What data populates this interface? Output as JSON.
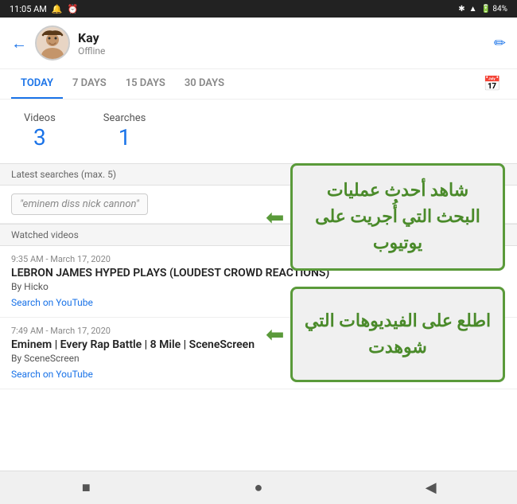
{
  "statusBar": {
    "time": "11:05 AM",
    "icons": [
      "alarm",
      "bluetooth",
      "signal",
      "battery"
    ],
    "battery": "84"
  },
  "header": {
    "backLabel": "←",
    "name": "Kay",
    "status": "Offline",
    "editIcon": "✏"
  },
  "tabs": {
    "items": [
      {
        "label": "TODAY",
        "active": true
      },
      {
        "label": "7 DAYS",
        "active": false
      },
      {
        "label": "15 DAYS",
        "active": false
      },
      {
        "label": "30 DAYS",
        "active": false
      }
    ],
    "calendarIcon": "📅"
  },
  "stats": {
    "videos": {
      "label": "Videos",
      "value": "3"
    },
    "searches": {
      "label": "Searches",
      "value": "1"
    }
  },
  "latestSearches": {
    "sectionLabel": "Latest searches (max. 5)",
    "items": [
      {
        "term": "\"eminem diss nick cannon\""
      }
    ]
  },
  "watchedVideos": {
    "sectionLabel": "Watched videos",
    "items": [
      {
        "timestamp": "9:35 AM - March 17, 2020",
        "title": "LEBRON JAMES HYPED PLAYS (LOUDEST CROWD REACTIONS)",
        "channel": "By Hicko",
        "linkLabel": "Search on YouTube"
      },
      {
        "timestamp": "7:49 AM - March 17, 2020",
        "title": "Eminem | Every Rap Battle | 8 Mile | SceneScreen",
        "channel": "By SceneScreen",
        "linkLabel": "Search on YouTube"
      }
    ]
  },
  "overlays": {
    "top": {
      "text": "شاهد أحدث عمليات البحث التي أُجريت على يوتيوب"
    },
    "bottom": {
      "text": "اطلع على الفيديوهات التي شوهدت"
    }
  },
  "bottomNav": {
    "items": [
      "■",
      "●",
      "◀"
    ]
  }
}
